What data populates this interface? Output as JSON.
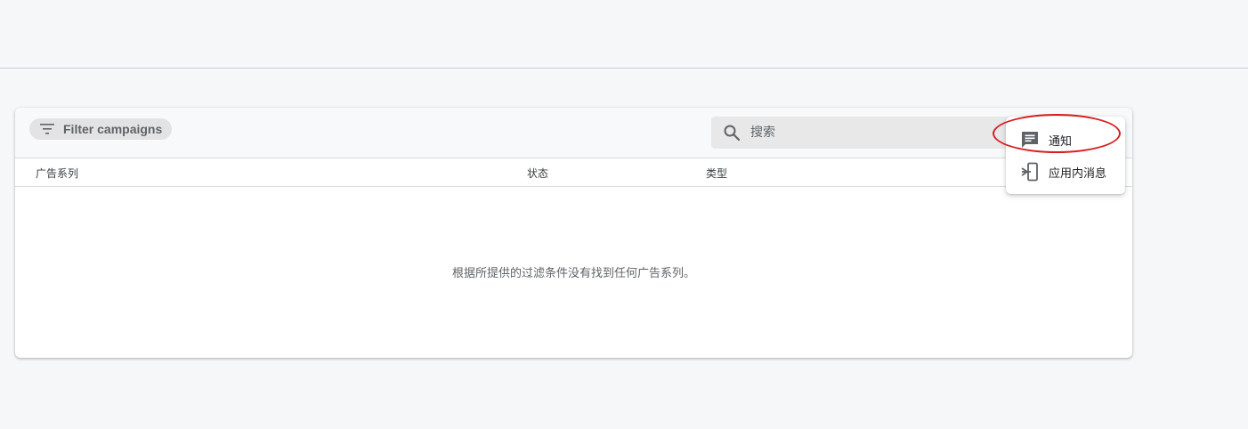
{
  "toolbar": {
    "filter_label": "Filter campaigns",
    "search_placeholder": "搜索"
  },
  "table": {
    "columns": [
      "广告系列",
      "状态",
      "类型"
    ],
    "empty_message": "根据所提供的过滤条件没有找到任何广告系列。"
  },
  "menu": {
    "items": [
      {
        "label": "通知",
        "icon": "message-icon"
      },
      {
        "label": "应用内消息",
        "icon": "in-app-message-icon"
      }
    ]
  },
  "annotation": {
    "highlight_color": "#d81e1e"
  }
}
